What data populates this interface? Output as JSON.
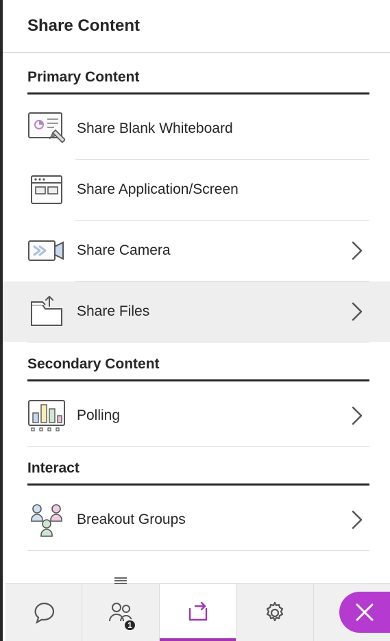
{
  "pageTitle": "Share Content",
  "sections": {
    "primary": {
      "title": "Primary Content",
      "items": {
        "whiteboard": "Share Blank Whiteboard",
        "application": "Share Application/Screen",
        "camera": "Share Camera",
        "files": "Share Files"
      }
    },
    "secondary": {
      "title": "Secondary Content",
      "items": {
        "polling": "Polling"
      }
    },
    "interact": {
      "title": "Interact",
      "items": {
        "breakout": "Breakout Groups"
      }
    }
  },
  "bottomBar": {
    "attendeesBadge": "1"
  }
}
